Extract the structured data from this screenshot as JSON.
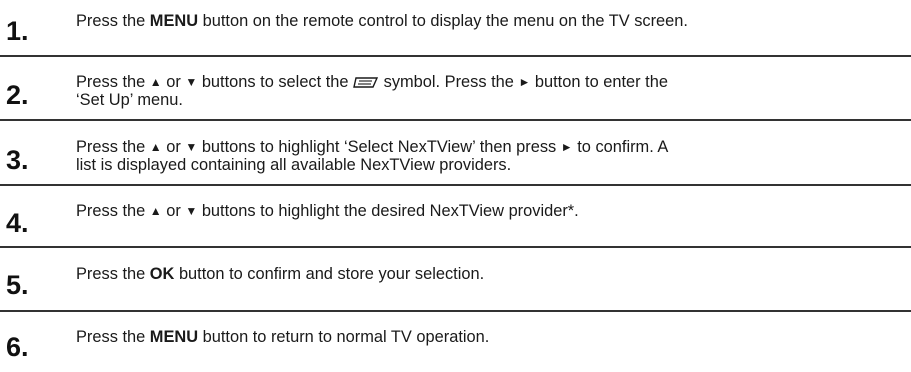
{
  "steps": [
    {
      "number": "1.",
      "parts": {
        "a": "Press the ",
        "b": "MENU",
        "c": " button on the remote control to display the menu on the TV screen."
      }
    },
    {
      "number": "2.",
      "parts": {
        "a": "Press the ",
        "up": "▲",
        "or": " or ",
        "down": "▼",
        "b": " buttons to select the ",
        "icon": "setup-symbol-icon",
        "c": " symbol. Press the ",
        "right": "►",
        "d": " button to enter the",
        "line2": "‘Set Up’ menu."
      }
    },
    {
      "number": "3.",
      "parts": {
        "a": "Press the ",
        "up": "▲",
        "or": " or ",
        "down": "▼",
        "b": " buttons to highlight ‘Select NexTView’ then press ",
        "right": "►",
        "c": " to confirm. A",
        "line2": "list is displayed containing all available NexTView providers."
      }
    },
    {
      "number": "4.",
      "parts": {
        "a": "Press the ",
        "up": "▲",
        "or": " or ",
        "down": "▼",
        "b": " buttons to highlight the desired NexTView provider*."
      }
    },
    {
      "number": "5.",
      "parts": {
        "a": "Press the ",
        "b": "OK",
        "c": " button to confirm and store your selection."
      }
    },
    {
      "number": "6.",
      "parts": {
        "a": "Press the ",
        "b": "MENU",
        "c": " button to return to normal TV operation."
      }
    }
  ],
  "colors": {
    "text": "#1a1a1a",
    "divider": "#333333",
    "background": "#ffffff"
  }
}
